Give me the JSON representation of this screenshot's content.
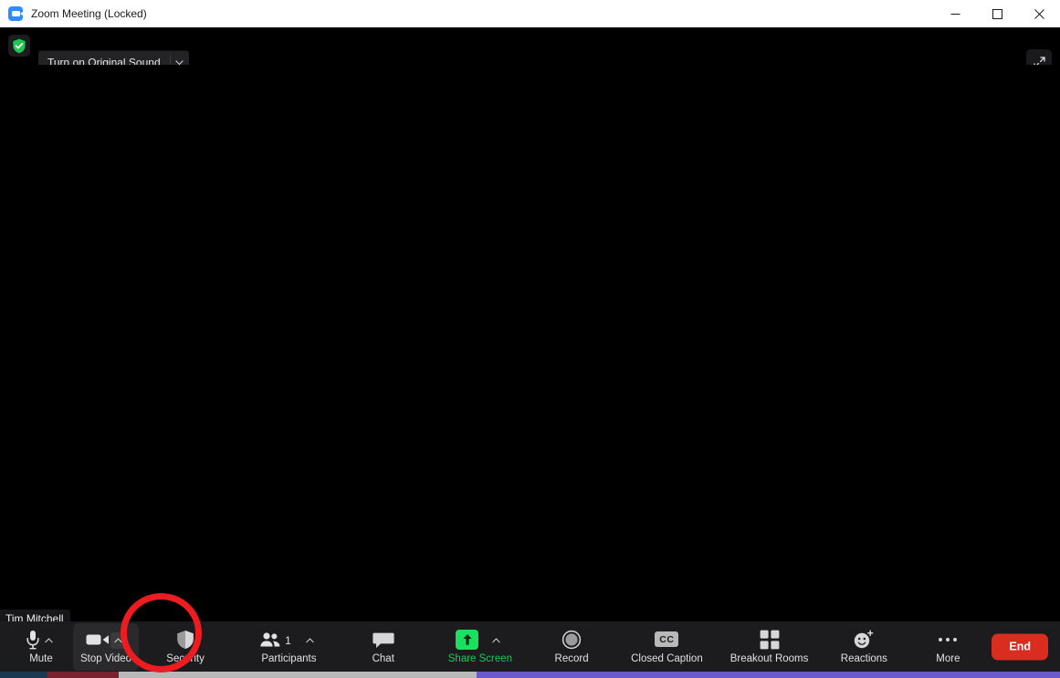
{
  "window": {
    "title": "Zoom Meeting (Locked)",
    "app_icon": "zoom-camera-icon",
    "controls": {
      "minimize": "minimize-icon",
      "maximize": "maximize-icon",
      "close": "close-icon"
    }
  },
  "topbar": {
    "security_badge": "shield-check-icon",
    "original_sound": {
      "label": "Turn on Original Sound",
      "caret": "chevron-down-icon"
    },
    "fullscreen": "enter-fullscreen-icon"
  },
  "stage": {
    "participant_name": "Tim Mitchell",
    "background": "#000000"
  },
  "annotation": {
    "shape": "circle",
    "color": "#ee1c20"
  },
  "toolbar": {
    "items": [
      {
        "label": "Mute",
        "icon": "microphone-icon",
        "chevron": true,
        "chevron_boxed": false,
        "hovered": false,
        "green": false
      },
      {
        "label": "Stop Video",
        "icon": "video-camera-icon",
        "chevron": true,
        "chevron_boxed": true,
        "hovered": true,
        "green": false
      },
      {
        "label": "Security",
        "icon": "shield-icon",
        "chevron": false,
        "chevron_boxed": false,
        "hovered": false,
        "green": false
      },
      {
        "label": "Participants",
        "icon": "people-icon",
        "chevron": true,
        "chevron_boxed": false,
        "hovered": false,
        "green": false,
        "count": "1"
      },
      {
        "label": "Chat",
        "icon": "chat-bubble-icon",
        "chevron": false,
        "chevron_boxed": false,
        "hovered": false,
        "green": false
      },
      {
        "label": "Share Screen",
        "icon": "share-screen-icon",
        "chevron": true,
        "chevron_boxed": false,
        "hovered": false,
        "green": true
      },
      {
        "label": "Record",
        "icon": "record-circle-icon",
        "chevron": false,
        "chevron_boxed": false,
        "hovered": false,
        "green": false
      },
      {
        "label": "Closed Caption",
        "icon": "closed-caption-icon",
        "chevron": false,
        "chevron_boxed": false,
        "hovered": false,
        "green": false
      },
      {
        "label": "Breakout Rooms",
        "icon": "breakout-rooms-icon",
        "chevron": false,
        "chevron_boxed": false,
        "hovered": false,
        "green": false
      },
      {
        "label": "Reactions",
        "icon": "reactions-smiley-icon",
        "chevron": false,
        "chevron_boxed": false,
        "hovered": false,
        "green": false
      },
      {
        "label": "More",
        "icon": "more-dots-icon",
        "chevron": false,
        "chevron_boxed": false,
        "hovered": false,
        "green": false
      }
    ],
    "end_button": {
      "label": "End",
      "color": "#d92d20"
    }
  },
  "colors": {
    "share_green": "#19e05f",
    "toolbar_bg": "#1c1c1e",
    "title_bg": "#ffffff",
    "annotation_red": "#ee1c20"
  }
}
